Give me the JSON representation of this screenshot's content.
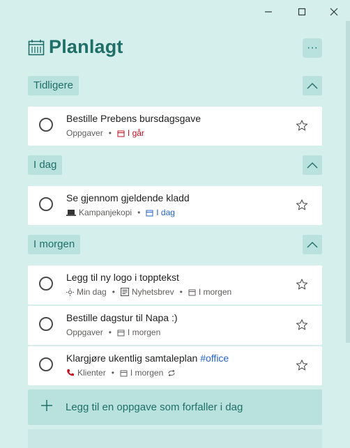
{
  "window": {
    "minimize_icon": "minimize-icon",
    "maximize_icon": "maximize-icon",
    "close_icon": "close-icon"
  },
  "header": {
    "title": "Planlagt",
    "icon": "calendar-icon",
    "more_label": "···"
  },
  "groups": [
    {
      "label": "Tidligere",
      "tasks": [
        {
          "title": "Bestille Prebens bursdagsgave",
          "list": "Oppgaver",
          "due": "I går",
          "due_color": "#c50f1f"
        }
      ]
    },
    {
      "label": "I dag",
      "tasks": [
        {
          "title": "Se gjennom gjeldende kladd",
          "list": "Kampanjekopi",
          "list_icon": "laptop-icon",
          "due": "I dag",
          "due_color": "#2564cf"
        }
      ]
    },
    {
      "label": "I morgen",
      "tasks": [
        {
          "title": "Legg til ny logo i topptekst",
          "myday": "Min dag",
          "list": "Nyhetsbrev",
          "list_icon": "newspaper-icon",
          "due": "I morgen"
        },
        {
          "title": "Bestille dagstur til Napa :)",
          "list": "Oppgaver",
          "due": "I morgen"
        },
        {
          "title": "Klargjøre ukentlig samtaleplan",
          "tag": "#office",
          "list": "Klienter",
          "list_icon": "phone-icon",
          "due": "I morgen",
          "repeat_icon": "repeat-icon"
        }
      ]
    }
  ],
  "add_task": {
    "label": "Legg til en oppgave som forfaller i dag",
    "icon": "plus-icon"
  },
  "colors": {
    "background": "#d5efed",
    "accent": "#1f6f68",
    "chip": "#b9e2de",
    "overdue": "#c50f1f",
    "today": "#2564cf"
  }
}
